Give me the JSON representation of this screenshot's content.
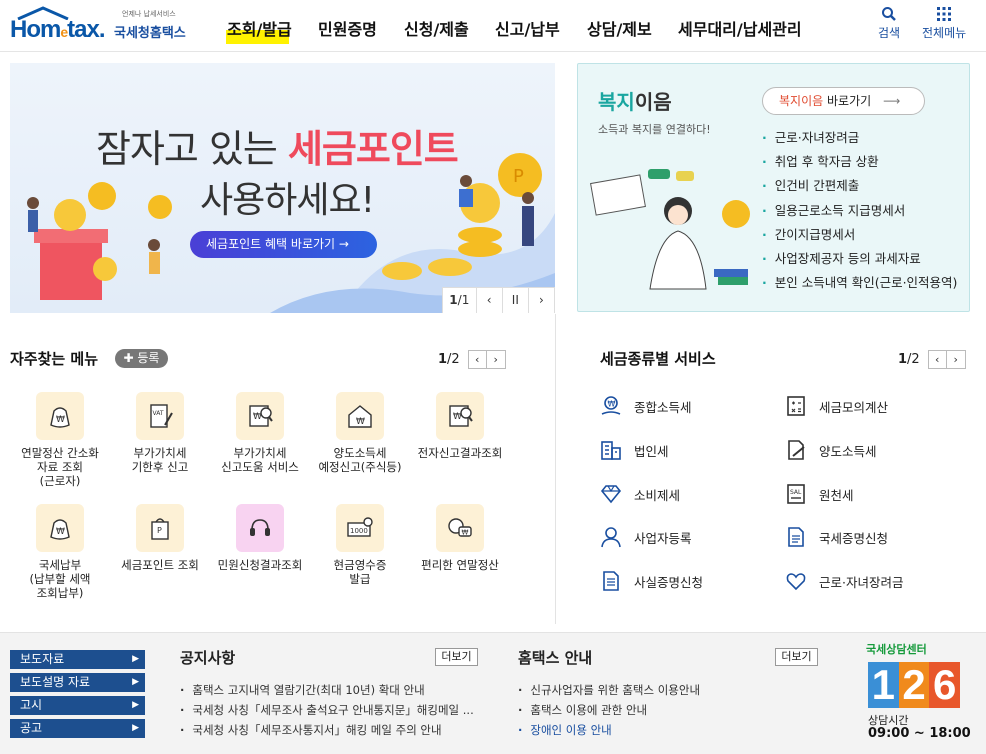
{
  "header": {
    "logo_main": "Hom",
    "logo_e": "e",
    "logo_tail": "tax.",
    "logo_small": "언제나 납세서비스",
    "logo_kor": "국세청홈택스",
    "nav": [
      "조회/발급",
      "민원증명",
      "신청/제출",
      "신고/납부",
      "상담/제보",
      "세무대리/납세관리"
    ],
    "search_label": "검색",
    "allmenu_label": "전체메뉴"
  },
  "banner": {
    "line1_a": "잠자고 있는 ",
    "line1_b": "세금포인트",
    "line2": "사용하세요!",
    "button": "세금포인트 혜택 바로가기  →",
    "page_current": "1",
    "page_total": "/1",
    "prev": "‹",
    "pause": "II",
    "next": "›"
  },
  "welfare": {
    "title_a": "복지",
    "title_b": "이음",
    "subtitle": "소득과 복지를 연결하다!",
    "button_a": "복지이음",
    "button_b": " 바로가기",
    "items": [
      "근로·자녀장려금",
      "취업 후 학자금 상환",
      "인건비 간편제출",
      "일용근로소득 지급명세서",
      "간이지급명세서",
      "사업장제공자 등의 과세자료",
      "본인 소득내역 확인(근로·인적용역)"
    ]
  },
  "frequent": {
    "title": "자주찾는 메뉴",
    "register": "✚ 등록",
    "page_current": "1",
    "page_total": "/2",
    "prev": "‹",
    "next": "›",
    "items": [
      {
        "lines": [
          "연말정산 간소화",
          "자료 조회",
          "(근로자)"
        ],
        "icon": "money-bag-icon"
      },
      {
        "lines": [
          "부가가치세",
          "기한후 신고"
        ],
        "icon": "vat-document-icon"
      },
      {
        "lines": [
          "부가가치세",
          "신고도움 서비스"
        ],
        "icon": "won-search-icon"
      },
      {
        "lines": [
          "양도소득세",
          "예정신고(주식등)"
        ],
        "icon": "house-won-icon"
      },
      {
        "lines": [
          "전자신고결과조회"
        ],
        "icon": "result-search-icon"
      },
      {
        "lines": [
          "국세납부",
          "(납부할 세액",
          "조회납부)"
        ],
        "icon": "money-bag-icon"
      },
      {
        "lines": [
          "세금포인트 조회"
        ],
        "icon": "point-bag-icon"
      },
      {
        "lines": [
          "민원신청결과조회"
        ],
        "icon": "headset-icon"
      },
      {
        "lines": [
          "현금영수증",
          "발급"
        ],
        "icon": "receipt-icon"
      },
      {
        "lines": [
          "편리한 연말정산"
        ],
        "icon": "chat-won-icon"
      }
    ]
  },
  "taxservices": {
    "title": "세금종류별 서비스",
    "page_current": "1",
    "page_total": "/2",
    "prev": "‹",
    "next": "›",
    "items": [
      {
        "label": "종합소득세",
        "icon": "hand-won-icon"
      },
      {
        "label": "세금모의계산",
        "icon": "calculator-icon"
      },
      {
        "label": "법인세",
        "icon": "building-icon"
      },
      {
        "label": "양도소득세",
        "icon": "document-edit-icon"
      },
      {
        "label": "소비제세",
        "icon": "diamond-icon"
      },
      {
        "label": "원천세",
        "icon": "salary-doc-icon"
      },
      {
        "label": "사업자등록",
        "icon": "user-icon"
      },
      {
        "label": "국세증명신청",
        "icon": "certificate-icon"
      },
      {
        "label": "사실증명신청",
        "icon": "fact-doc-icon"
      },
      {
        "label": "근로·자녀장려금",
        "icon": "heart-hands-icon"
      }
    ]
  },
  "footer": {
    "side_links": [
      "보도자료",
      "보도설명 자료",
      "고시",
      "공고"
    ],
    "notice_title": "공지사항",
    "notice_more": "더보기",
    "notices": [
      "홈택스 고지내역 열람기간(최대 10년) 확대 안내",
      "국세청 사칭「세무조사 출석요구 안내통지문」해킹메일 ...",
      "국세청 사칭「세무조사통지서」해킹 메일 주의 안내"
    ],
    "guide_title": "홈택스 안내",
    "guide_more": "더보기",
    "guides": [
      "신규사업자를 위한 홈택스 이용안내",
      "홈택스 이용에 관한 안내",
      "장애인 이용 안내"
    ],
    "cc_small": "국세상담센터",
    "cc_digits": [
      "1",
      "2",
      "6"
    ],
    "cc_label": "상담시간",
    "cc_hours": "09:00 ~ 18:00"
  }
}
